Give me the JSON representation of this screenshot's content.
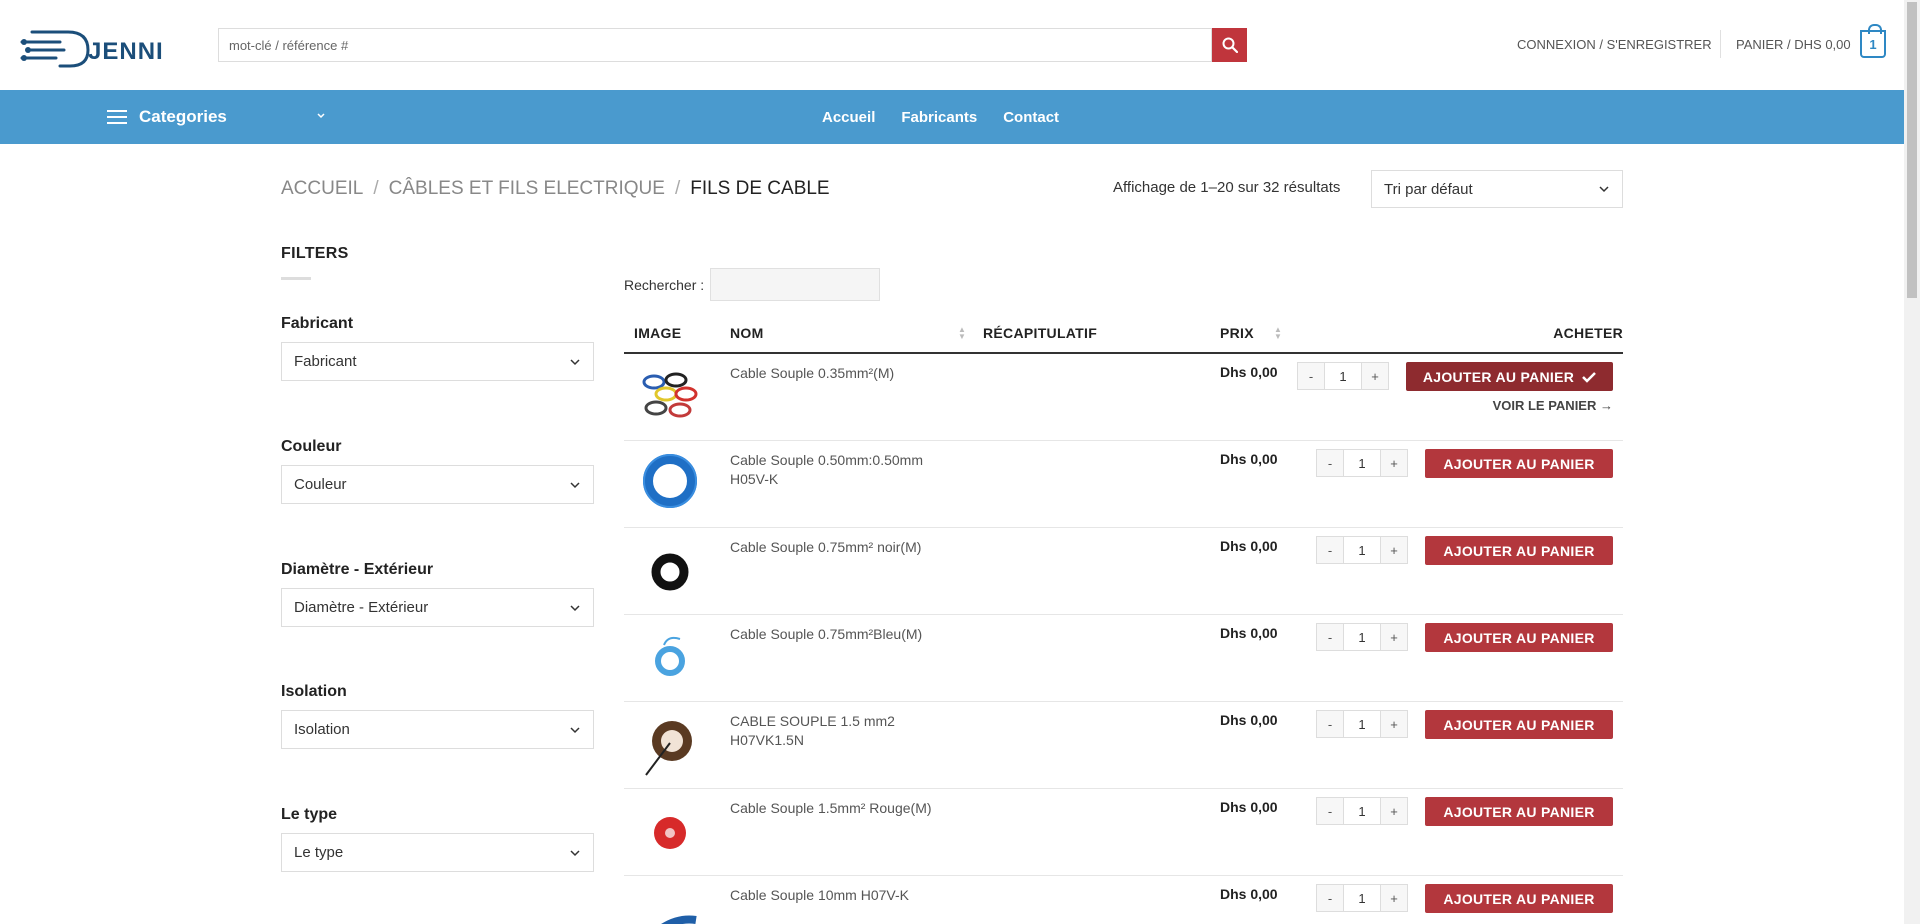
{
  "brand": {
    "name": "JENNI",
    "accent": "#2e88c4",
    "nav_color": "#4a9ace",
    "button_color": "#b3373d"
  },
  "search": {
    "placeholder": "mot-clé / référence #"
  },
  "header": {
    "account_label": "CONNEXION / S'ENREGISTRER",
    "cart_label": "PANIER / DHS 0,00",
    "cart_count": "1"
  },
  "nav": {
    "categories_label": "Categories",
    "links": [
      "Accueil",
      "Fabricants",
      "Contact"
    ]
  },
  "breadcrumb": {
    "items": [
      "ACCUEIL",
      "CÂBLES ET FILS ELECTRIQUE",
      "FILS DE CABLE"
    ],
    "separator": "/"
  },
  "results": {
    "count_text": "Affichage de 1–20 sur 32 résultats",
    "sort_value": "Tri par défaut"
  },
  "filters": {
    "title": "FILTERS",
    "groups": [
      {
        "label": "Fabricant",
        "value": "Fabricant"
      },
      {
        "label": "Couleur",
        "value": "Couleur"
      },
      {
        "label": "Diamètre - Extérieur",
        "value": "Diamètre - Extérieur"
      },
      {
        "label": "Isolation",
        "value": "Isolation"
      },
      {
        "label": "Le type",
        "value": "Le type"
      }
    ]
  },
  "table": {
    "search_label": "Rechercher :",
    "headers": {
      "image": "IMAGE",
      "name": "NOM",
      "summary": "RÉCAPITULATIF",
      "price": "PRIX",
      "buy": "ACHETER"
    },
    "add_label": "AJOUTER AU PANIER",
    "view_cart_label": "VOIR LE PANIER",
    "rows": [
      {
        "name": "Cable Souple 0.35mm²(M)",
        "price": "Dhs 0,00",
        "qty": "1",
        "image": "multicolor-cable-coils",
        "added": true
      },
      {
        "name": "Cable Souple 0.50mm:0.50mm H05V-K",
        "price": "Dhs 0,00",
        "qty": "1",
        "image": "blue-cable-coil",
        "added": false
      },
      {
        "name": "Cable Souple 0.75mm² noir(M)",
        "price": "Dhs 0,00",
        "qty": "1",
        "image": "black-cable-coil",
        "added": false
      },
      {
        "name": "Cable Souple 0.75mm²Bleu(M)",
        "price": "Dhs 0,00",
        "qty": "1",
        "image": "light-blue-cable-coil",
        "added": false
      },
      {
        "name": "CABLE SOUPLE 1.5 mm2 H07VK1.5N",
        "price": "Dhs 0,00",
        "qty": "1",
        "image": "brown-cable-coil",
        "added": false
      },
      {
        "name": "Cable Souple 1.5mm² Rouge(M)",
        "price": "Dhs 0,00",
        "qty": "1",
        "image": "red-cable-coil",
        "added": false
      },
      {
        "name": "Cable Souple 10mm H07V-K",
        "price": "Dhs 0,00",
        "qty": "1",
        "image": "blue-cable-coil",
        "added": false
      }
    ]
  }
}
